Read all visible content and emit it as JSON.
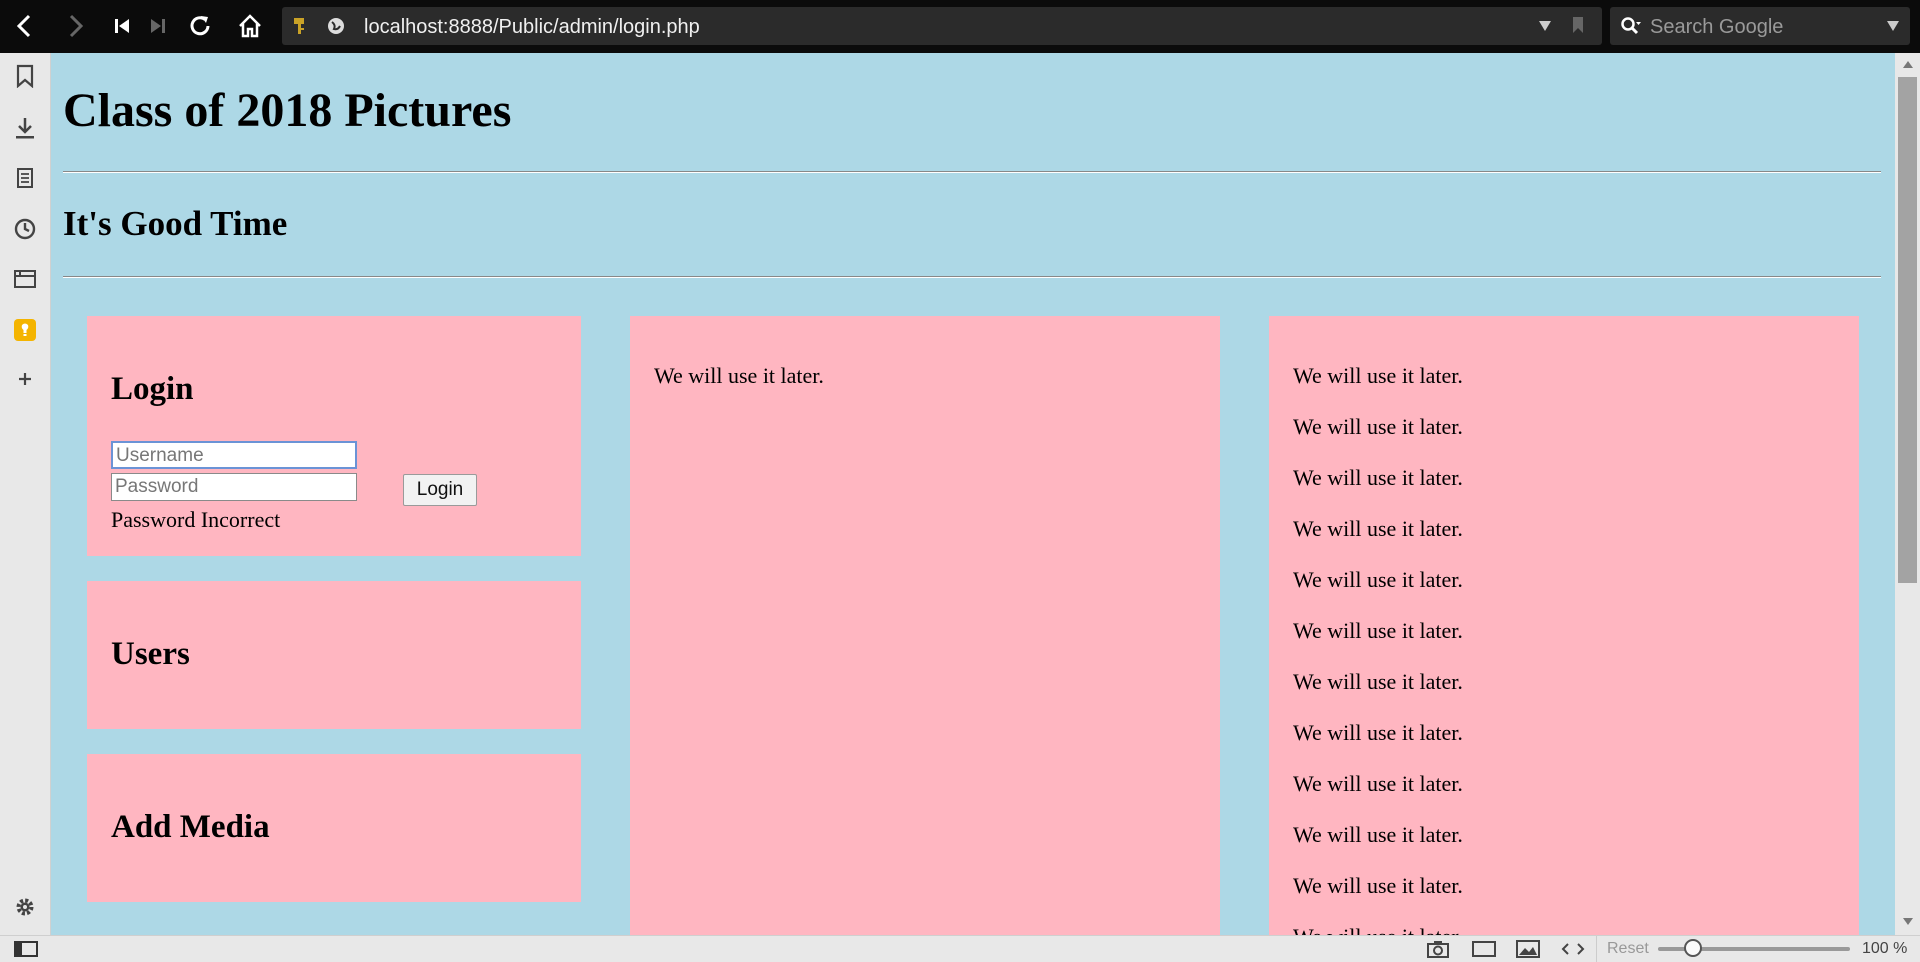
{
  "browser": {
    "url": "localhost:8888/Public/admin/login.php",
    "search_placeholder": "Search Google",
    "status": {
      "reset_label": "Reset",
      "zoom": "100 %"
    }
  },
  "page": {
    "title": "Class of 2018 Pictures",
    "subtitle": "It's Good Time",
    "login": {
      "heading": "Login",
      "username_placeholder": "Username",
      "password_placeholder": "Password",
      "button_label": "Login",
      "error": "Password Incorrect"
    },
    "users": {
      "heading": "Users"
    },
    "add_media": {
      "heading": "Add Media"
    },
    "middle_panel": {
      "text": "We will use it later."
    },
    "right_panel": {
      "lines": [
        "We will use it later.",
        "We will use it later.",
        "We will use it later.",
        "We will use it later.",
        "We will use it later.",
        "We will use it later.",
        "We will use it later.",
        "We will use it later.",
        "We will use it later.",
        "We will use it later.",
        "We will use it later.",
        "We will use it later."
      ]
    }
  }
}
